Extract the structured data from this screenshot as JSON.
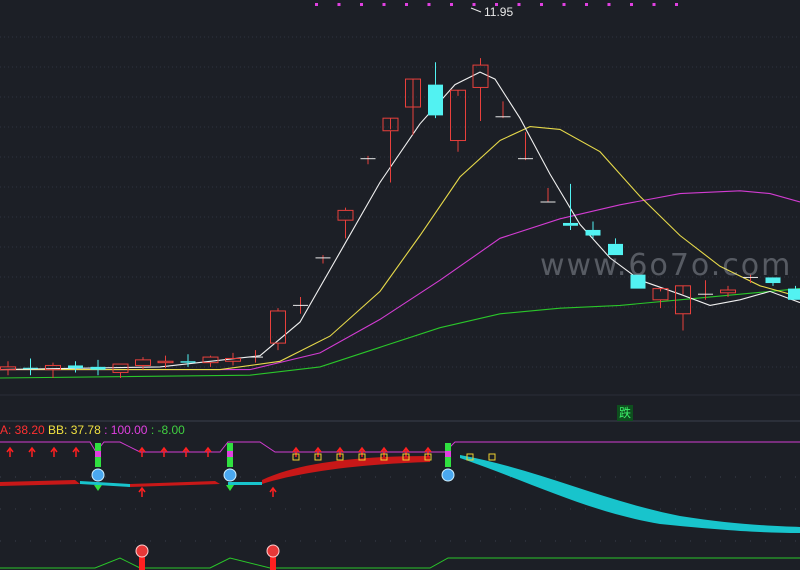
{
  "chart_data": {
    "type": "candlestick",
    "main": {
      "price_range": [
        0.0,
        13.6
      ],
      "high_annotation": "11.95",
      "candles": [
        {
          "o": 0.8,
          "h": 1.1,
          "l": 0.6,
          "c": 0.9
        },
        {
          "o": 0.85,
          "h": 1.2,
          "l": 0.6,
          "c": 0.8
        },
        {
          "o": 0.8,
          "h": 1.05,
          "l": 0.5,
          "c": 0.95
        },
        {
          "o": 0.95,
          "h": 1.1,
          "l": 0.7,
          "c": 0.85
        },
        {
          "o": 0.9,
          "h": 1.15,
          "l": 0.6,
          "c": 0.8
        },
        {
          "o": 0.7,
          "h": 1.0,
          "l": 0.5,
          "c": 1.0
        },
        {
          "o": 0.95,
          "h": 1.25,
          "l": 0.8,
          "c": 1.15
        },
        {
          "o": 1.05,
          "h": 1.3,
          "l": 0.85,
          "c": 1.1
        },
        {
          "o": 1.1,
          "h": 1.35,
          "l": 0.9,
          "c": 1.05
        },
        {
          "o": 1.05,
          "h": 1.3,
          "l": 0.9,
          "c": 1.25
        },
        {
          "o": 1.1,
          "h": 1.4,
          "l": 0.95,
          "c": 1.2
        },
        {
          "o": 1.25,
          "h": 1.5,
          "l": 1.05,
          "c": 1.25
        },
        {
          "o": 1.75,
          "h": 3.0,
          "l": 1.5,
          "c": 2.9
        },
        {
          "o": 3.1,
          "h": 3.4,
          "l": 2.8,
          "c": 3.1
        },
        {
          "o": 4.8,
          "h": 4.9,
          "l": 4.6,
          "c": 4.8
        },
        {
          "o": 6.15,
          "h": 6.6,
          "l": 5.5,
          "c": 6.5
        },
        {
          "o": 8.35,
          "h": 8.45,
          "l": 8.15,
          "c": 8.35
        },
        {
          "o": 9.35,
          "h": 9.4,
          "l": 7.5,
          "c": 9.8
        },
        {
          "o": 10.2,
          "h": 10.2,
          "l": 9.2,
          "c": 11.2
        },
        {
          "o": 11.0,
          "h": 11.8,
          "l": 9.8,
          "c": 9.9
        },
        {
          "o": 9.0,
          "h": 10.6,
          "l": 8.6,
          "c": 10.8
        },
        {
          "o": 10.9,
          "h": 11.95,
          "l": 9.7,
          "c": 11.7
        },
        {
          "o": 9.85,
          "h": 10.4,
          "l": 9.8,
          "c": 9.85
        },
        {
          "o": 8.35,
          "h": 9.3,
          "l": 8.3,
          "c": 8.35
        },
        {
          "o": 6.8,
          "h": 7.3,
          "l": 6.8,
          "c": 6.8
        },
        {
          "o": 6.05,
          "h": 7.45,
          "l": 5.8,
          "c": 5.95
        },
        {
          "o": 5.8,
          "h": 6.1,
          "l": 5.5,
          "c": 5.6
        },
        {
          "o": 5.3,
          "h": 5.5,
          "l": 4.9,
          "c": 4.9
        },
        {
          "o": 4.2,
          "h": 4.2,
          "l": 3.7,
          "c": 3.7
        },
        {
          "o": 3.3,
          "h": 3.6,
          "l": 3.0,
          "c": 3.7
        },
        {
          "o": 2.8,
          "h": 3.5,
          "l": 2.2,
          "c": 3.8
        },
        {
          "o": 3.5,
          "h": 4.0,
          "l": 3.3,
          "c": 3.5
        },
        {
          "o": 3.55,
          "h": 3.8,
          "l": 3.4,
          "c": 3.65
        },
        {
          "o": 4.1,
          "h": 4.2,
          "l": 3.9,
          "c": 4.1
        },
        {
          "o": 4.1,
          "h": 4.1,
          "l": 3.8,
          "c": 3.9
        },
        {
          "o": 3.7,
          "h": 3.8,
          "l": 3.3,
          "c": 3.3
        }
      ],
      "ma_white": {
        "color": "#f0f0f0",
        "values": [
          [
            0,
            0.8
          ],
          [
            160,
            0.9
          ],
          [
            260,
            1.3
          ],
          [
            300,
            2.5
          ],
          [
            340,
            5.0
          ],
          [
            380,
            7.5
          ],
          [
            420,
            9.6
          ],
          [
            455,
            11.0
          ],
          [
            480,
            11.45
          ],
          [
            495,
            11.2
          ],
          [
            520,
            9.8
          ],
          [
            550,
            7.8
          ],
          [
            580,
            6.0
          ],
          [
            610,
            4.8
          ],
          [
            640,
            4.0
          ],
          [
            680,
            3.5
          ],
          [
            710,
            3.1
          ],
          [
            740,
            3.3
          ],
          [
            770,
            3.6
          ],
          [
            800,
            3.2
          ]
        ]
      },
      "ma_yellow": {
        "color": "#e6d94a",
        "values": [
          [
            0,
            0.8
          ],
          [
            220,
            0.8
          ],
          [
            280,
            1.1
          ],
          [
            330,
            2.0
          ],
          [
            380,
            3.6
          ],
          [
            420,
            5.6
          ],
          [
            460,
            7.7
          ],
          [
            500,
            9.0
          ],
          [
            530,
            9.5
          ],
          [
            560,
            9.4
          ],
          [
            600,
            8.6
          ],
          [
            640,
            7.0
          ],
          [
            680,
            5.6
          ],
          [
            720,
            4.5
          ],
          [
            760,
            3.8
          ],
          [
            800,
            3.4
          ]
        ]
      },
      "ma_magenta": {
        "color": "#d23cd2",
        "values": [
          [
            0,
            0.8
          ],
          [
            250,
            0.8
          ],
          [
            320,
            1.4
          ],
          [
            380,
            2.6
          ],
          [
            440,
            4.0
          ],
          [
            500,
            5.5
          ],
          [
            560,
            6.2
          ],
          [
            620,
            6.7
          ],
          [
            680,
            7.1
          ],
          [
            740,
            7.2
          ],
          [
            770,
            7.1
          ],
          [
            800,
            6.8
          ]
        ]
      },
      "ma_green": {
        "color": "#2ac62a",
        "values": [
          [
            0,
            0.5
          ],
          [
            250,
            0.6
          ],
          [
            320,
            0.9
          ],
          [
            380,
            1.6
          ],
          [
            440,
            2.3
          ],
          [
            500,
            2.8
          ],
          [
            560,
            3.0
          ],
          [
            620,
            3.1
          ],
          [
            680,
            3.3
          ],
          [
            740,
            3.5
          ],
          [
            800,
            3.7
          ]
        ]
      }
    },
    "indicator": {
      "label_a": "A: 38.20",
      "label_b": "BB: 37.78",
      "label_c": ": 100.00",
      "label_d": ": -8.00",
      "color_a": "#ff3030",
      "color_b": "#f0e040",
      "color_c": "#e040e0",
      "color_d": "#40d040",
      "signal_text": "跌"
    }
  },
  "watermark": "www.6o7o.com"
}
